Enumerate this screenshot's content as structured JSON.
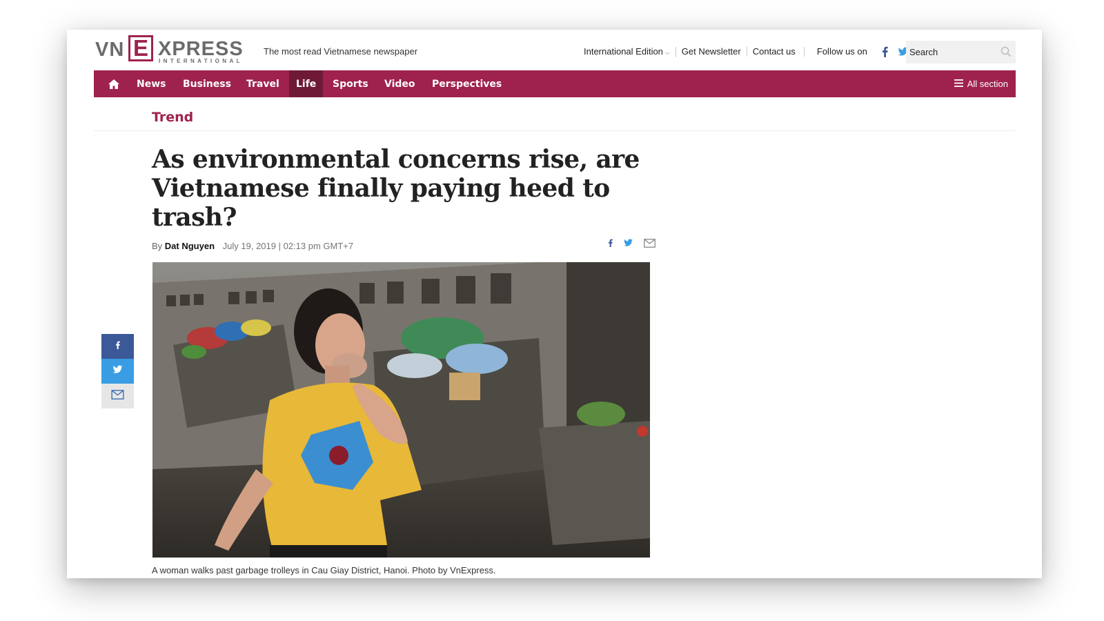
{
  "brand": {
    "logo_text": "VNEXPRESS INTERNATIONAL",
    "logo_vn": "VN",
    "logo_e": "E",
    "logo_xpress": "XPRESS",
    "logo_international": "INTERNATIONAL",
    "tagline": "The most read Vietnamese newspaper",
    "accent_color": "#9f224e"
  },
  "topbar": {
    "edition_label": "International Edition",
    "newsletter_label": "Get Newsletter",
    "contact_label": "Contact us",
    "follow_label": "Follow us on",
    "search_placeholder": "Search",
    "icons": [
      "facebook-icon",
      "twitter-icon",
      "search-icon",
      "chevron-down-icon"
    ]
  },
  "nav": {
    "items": [
      {
        "label": "News"
      },
      {
        "label": "Business"
      },
      {
        "label": "Travel"
      },
      {
        "label": "Life",
        "active": true
      },
      {
        "label": "Sports"
      },
      {
        "label": "Video"
      },
      {
        "label": "Perspectives"
      }
    ],
    "all_section_label": "All section",
    "icons": [
      "home-icon",
      "menu-icon"
    ]
  },
  "article": {
    "category": "Trend",
    "title": "As environmental concerns rise, are Vietnamese finally paying heed to trash?",
    "by_label": "By",
    "author": "Dat Nguyen",
    "date": "July 19, 2019 | 02:13 pm GMT+7",
    "photo_caption": "A woman walks past garbage trolleys in Cau Giay District, Hanoi. Photo by VnExpress.",
    "share_icons": [
      "facebook-icon",
      "twitter-icon",
      "mail-icon"
    ]
  },
  "colors": {
    "facebook": "#3b5998",
    "twitter": "#3a9de3",
    "nav_active": "#6e1a36"
  }
}
